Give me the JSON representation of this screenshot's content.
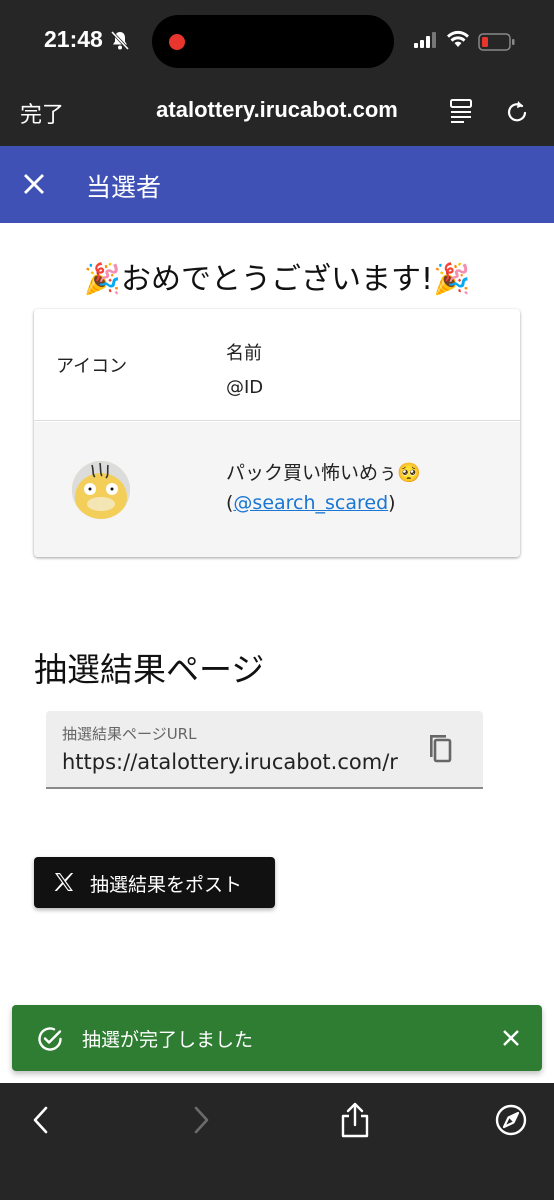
{
  "status_bar": {
    "time": "21:48",
    "battery_color": "#e8352d"
  },
  "browser": {
    "done_label": "完了",
    "url": "atalottery.irucabot.com",
    "icons": [
      "reader-icon",
      "reload-icon"
    ]
  },
  "app_bar": {
    "title": "当選者",
    "color": "#3f51b5",
    "close_icon": "close-icon"
  },
  "main": {
    "congrats": "🎉おめでとうございます!🎉",
    "table": {
      "header_icon": "アイコン",
      "header_name": "名前",
      "header_id": "@ID",
      "rows": [
        {
          "name": "パック買い怖いめぅ🥺",
          "paren_open": "(",
          "handle": "@search_scared",
          "paren_close": ")"
        }
      ]
    },
    "result_section_title": "抽選結果ページ",
    "url_field": {
      "label": "抽選結果ページURL",
      "value": "https://atalottery.irucabot.com/re"
    },
    "post_button": "抽選結果をポスト"
  },
  "snackbar": {
    "message": "抽選が完了しました",
    "color": "#2e7d32"
  },
  "bottom_bar": {
    "icons": [
      "back-icon",
      "forward-icon",
      "share-icon",
      "compass-icon"
    ]
  }
}
